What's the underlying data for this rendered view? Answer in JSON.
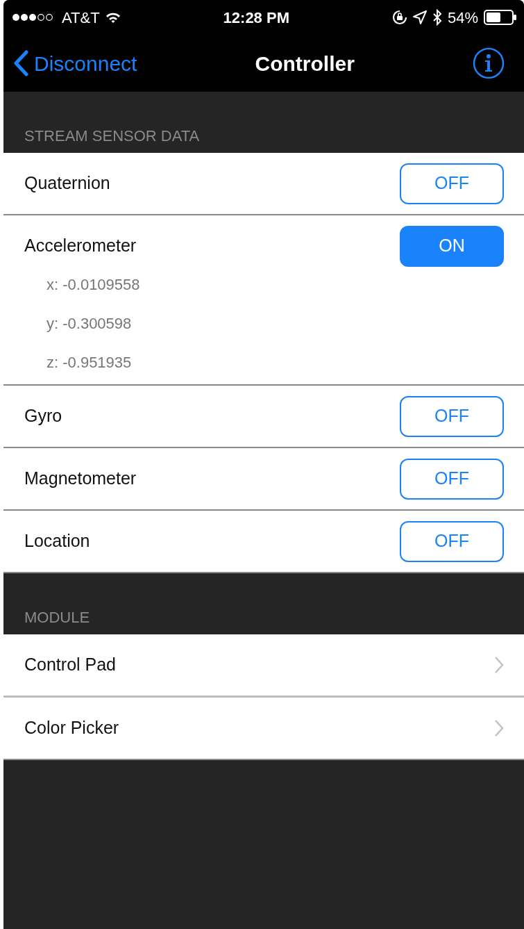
{
  "status_bar": {
    "carrier": "AT&T",
    "time": "12:28 PM",
    "battery": "54%"
  },
  "nav_bar": {
    "back": "Disconnect",
    "title": "Controller"
  },
  "sections": [
    {
      "header": "STREAM SENSOR DATA",
      "rows": [
        {
          "kind": "toggle",
          "label": "Quaternion",
          "button": "OFF",
          "on": false,
          "readings": []
        },
        {
          "kind": "toggle",
          "label": "Accelerometer",
          "button": "ON",
          "on": true,
          "readings": [
            "x: -0.0109558",
            "y: -0.300598",
            "z: -0.951935"
          ]
        },
        {
          "kind": "toggle",
          "label": "Gyro",
          "button": "OFF",
          "on": false,
          "readings": []
        },
        {
          "kind": "toggle",
          "label": "Magnetometer",
          "button": "OFF",
          "on": false,
          "readings": []
        },
        {
          "kind": "toggle",
          "label": "Location",
          "button": "OFF",
          "on": false,
          "readings": []
        }
      ]
    },
    {
      "header": "MODULE",
      "rows": [
        {
          "kind": "link",
          "label": "Control Pad"
        },
        {
          "kind": "link",
          "label": "Color Picker"
        }
      ]
    }
  ]
}
